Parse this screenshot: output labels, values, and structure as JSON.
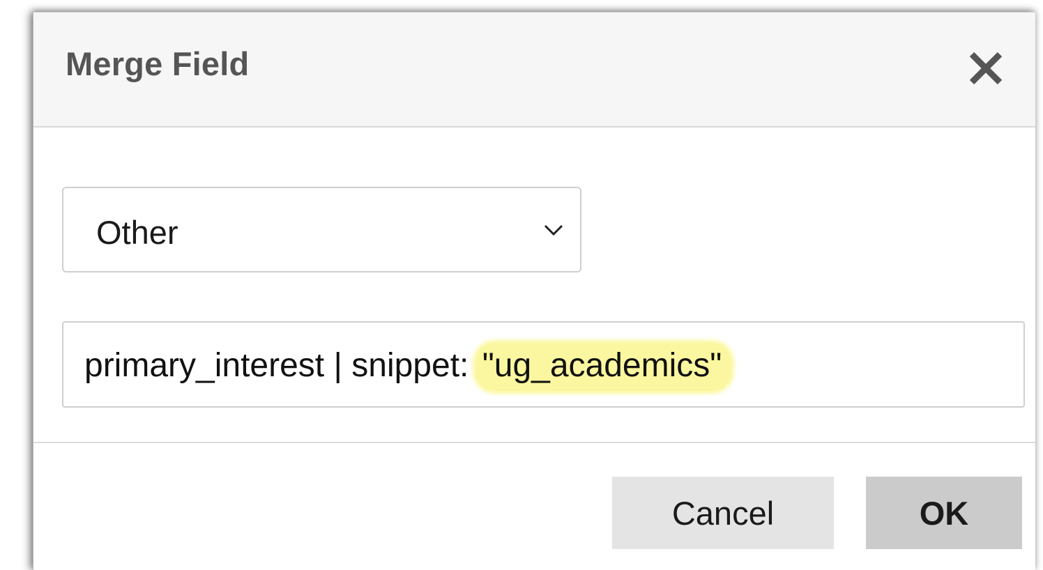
{
  "dialog": {
    "title": "Merge Field",
    "close_icon": "close-icon"
  },
  "category_select": {
    "selected_value": "Other",
    "chevron_icon": "chevron-down-icon"
  },
  "merge_field_input": {
    "value_prefix": "primary_interest | snippet:",
    "value_highlighted": "\"ug_academics\"",
    "highlight_color": "#fbf7a0"
  },
  "footer": {
    "cancel_label": "Cancel",
    "ok_label": "OK"
  }
}
